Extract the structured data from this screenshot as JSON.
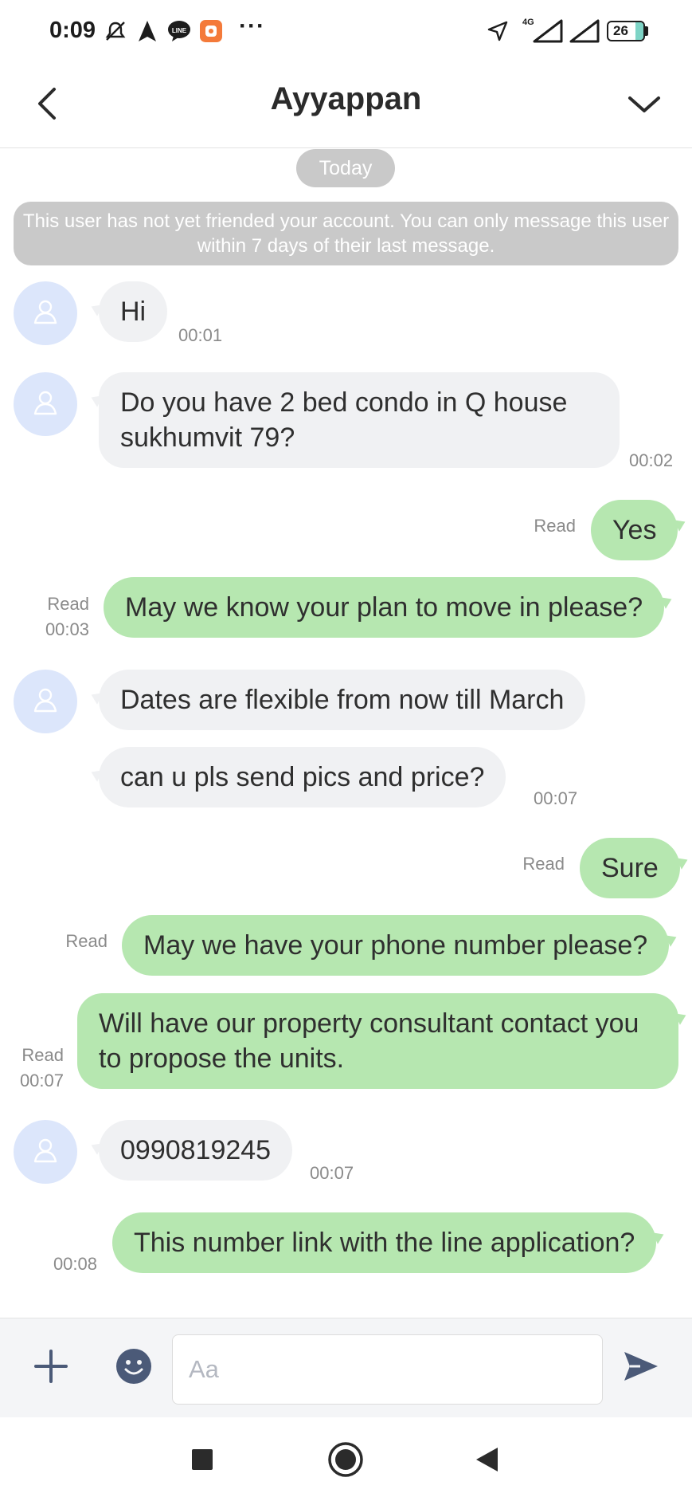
{
  "status_bar": {
    "time": "0:09",
    "more": "···",
    "network": "4G",
    "battery": "26",
    "icons": [
      "mute-icon",
      "navigation-icon",
      "line-icon",
      "app-icon",
      "location-icon",
      "signal-icon",
      "signal-icon",
      "battery-icon"
    ]
  },
  "header": {
    "title": "Ayyappan",
    "back_icon": "chevron-left-icon",
    "menu_icon": "chevron-down-icon"
  },
  "chat": {
    "date_label": "Today",
    "notice": "This user has not yet friended your account. You can only message this user within 7 days of their last message.",
    "messages": [
      {
        "direction": "in",
        "text": "Hi",
        "time": "00:01"
      },
      {
        "direction": "in",
        "text": "Do you have 2 bed condo in Q house sukhumvit 79?",
        "time": "00:02"
      },
      {
        "direction": "out",
        "text": "Yes",
        "status": "Read"
      },
      {
        "direction": "out",
        "text": "May we know your plan to move in please?",
        "status": "Read",
        "time": "00:03"
      },
      {
        "direction": "in",
        "text": "Dates are flexible from now till March"
      },
      {
        "direction": "in",
        "text": "can u pls send pics and price?",
        "time": "00:07"
      },
      {
        "direction": "out",
        "text": "Sure",
        "status": "Read"
      },
      {
        "direction": "out",
        "text": "May we have your phone number please?",
        "status": "Read"
      },
      {
        "direction": "out",
        "text": "Will have our property consultant contact you to propose the units.",
        "status": "Read",
        "time": "00:07"
      },
      {
        "direction": "in",
        "text": "0990819245",
        "time": "00:07"
      },
      {
        "direction": "out",
        "text": "This number link with the line application?",
        "time": "00:08"
      }
    ]
  },
  "input_bar": {
    "placeholder": "Aa",
    "value": "",
    "icons": [
      "plus-icon",
      "emoji-icon",
      "send-icon"
    ]
  },
  "nav_bar": {
    "icons": [
      "recents-square-icon",
      "home-circle-icon",
      "back-triangle-icon"
    ]
  },
  "colors": {
    "outgoing_bubble": "#b6e7b0",
    "incoming_bubble": "#f0f1f3",
    "avatar_bg": "#dce6fb",
    "notice_bg": "#c9c9c9",
    "accent_icon": "#4b5a78"
  }
}
